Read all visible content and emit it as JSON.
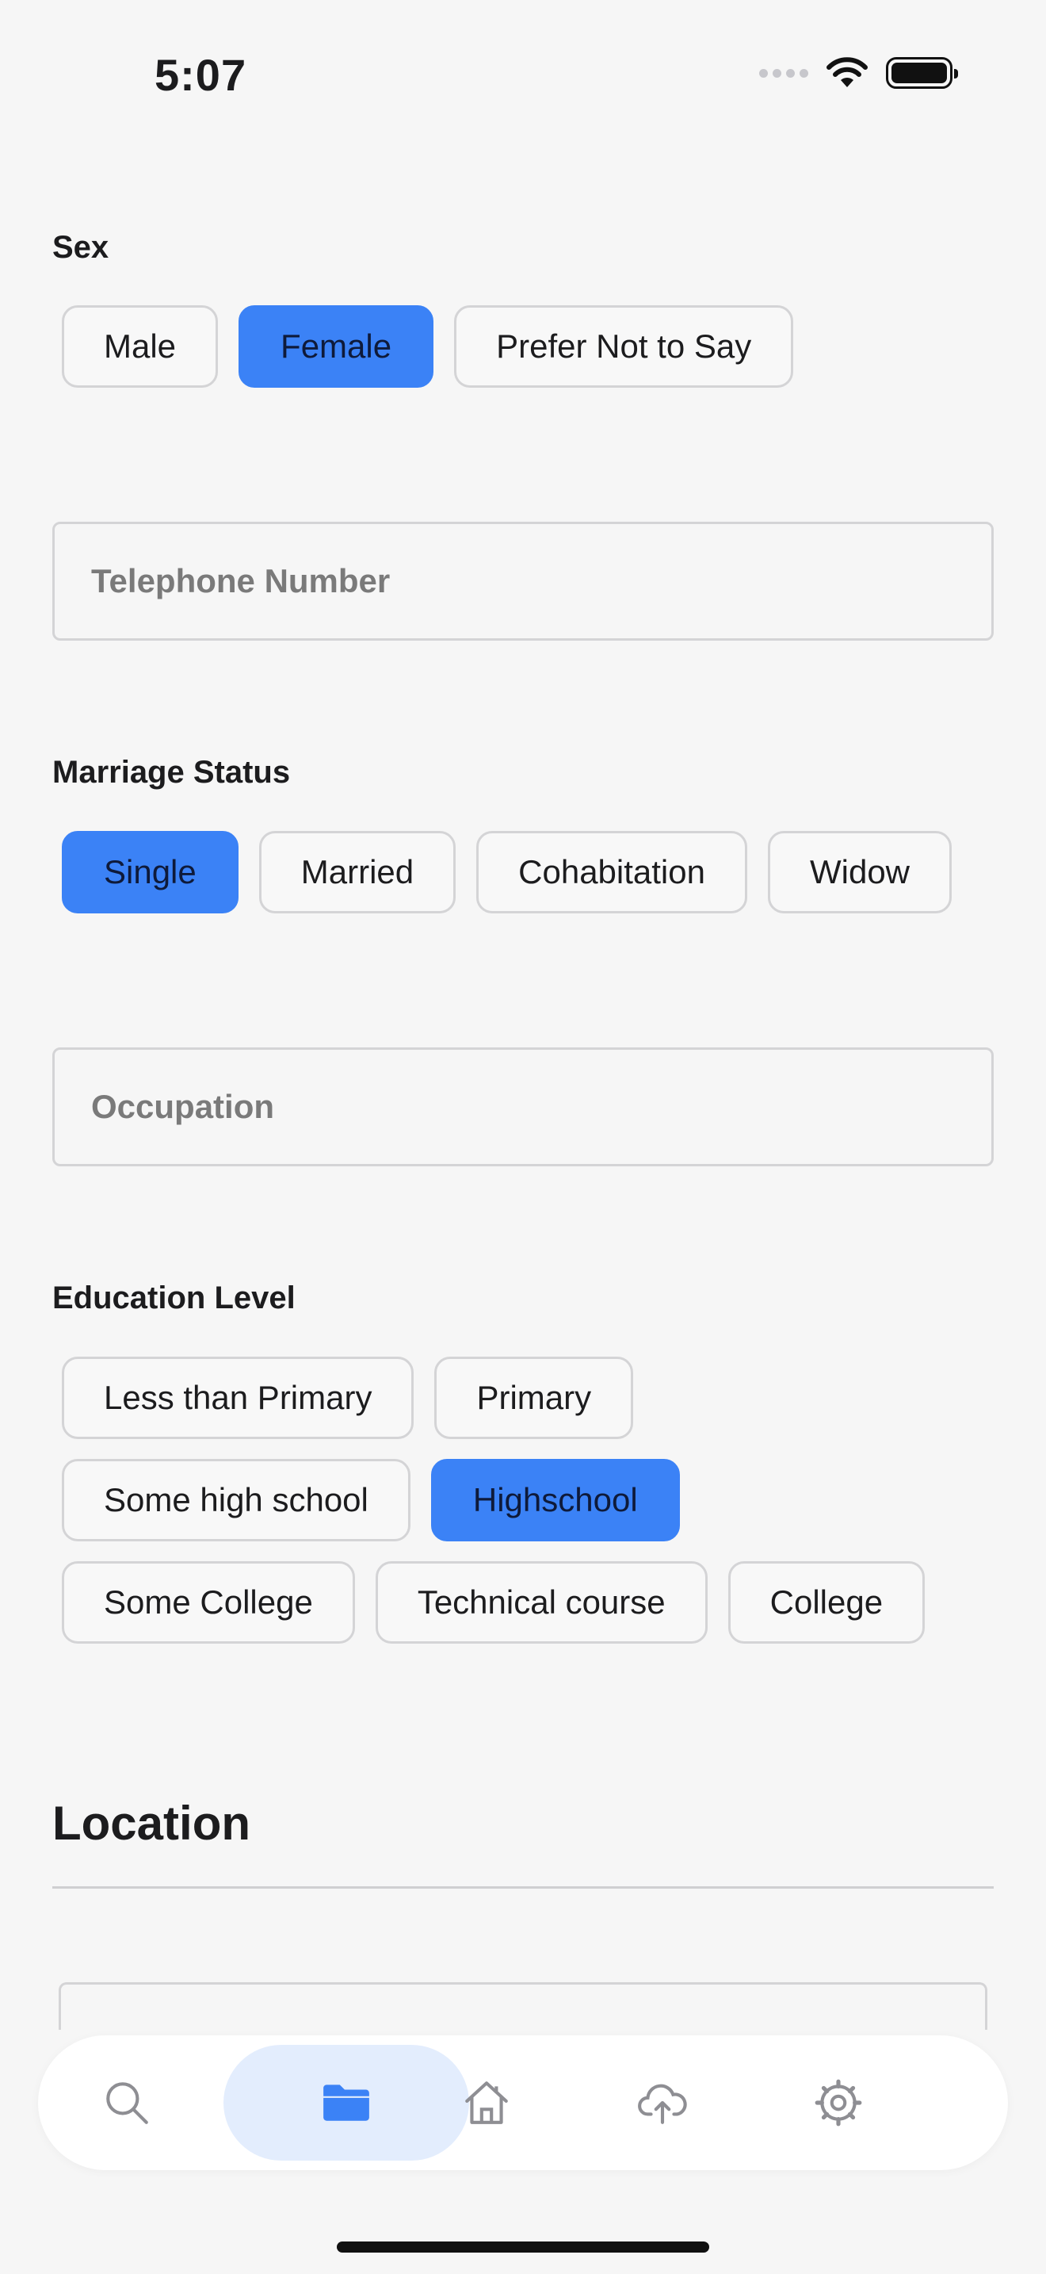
{
  "status_bar": {
    "time": "5:07"
  },
  "sex": {
    "label": "Sex",
    "options": [
      "Male",
      "Female",
      "Prefer Not to Say"
    ],
    "selected": "Female"
  },
  "telephone": {
    "placeholder": "Telephone Number"
  },
  "marriage": {
    "label": "Marriage Status",
    "options": [
      "Single",
      "Married",
      "Cohabitation",
      "Widow"
    ],
    "selected": "Single"
  },
  "occupation": {
    "placeholder": "Occupation"
  },
  "education": {
    "label": "Education Level",
    "rows": [
      [
        "Less than Primary",
        "Primary"
      ],
      [
        "Some high school",
        "Highschool"
      ],
      [
        "Some College",
        "Technical course",
        "College"
      ]
    ],
    "selected": "Highschool"
  },
  "location": {
    "title": "Location"
  },
  "tab_bar": {
    "items": [
      {
        "icon": "search-icon"
      },
      {
        "icon": "folder-icon",
        "active": true
      },
      {
        "icon": "home-icon"
      },
      {
        "icon": "cloud-upload-icon"
      },
      {
        "icon": "gear-icon"
      }
    ]
  },
  "colors": {
    "accent": "#3b82f6",
    "accent_light": "#e3edfd",
    "background": "#f6f6f6"
  }
}
